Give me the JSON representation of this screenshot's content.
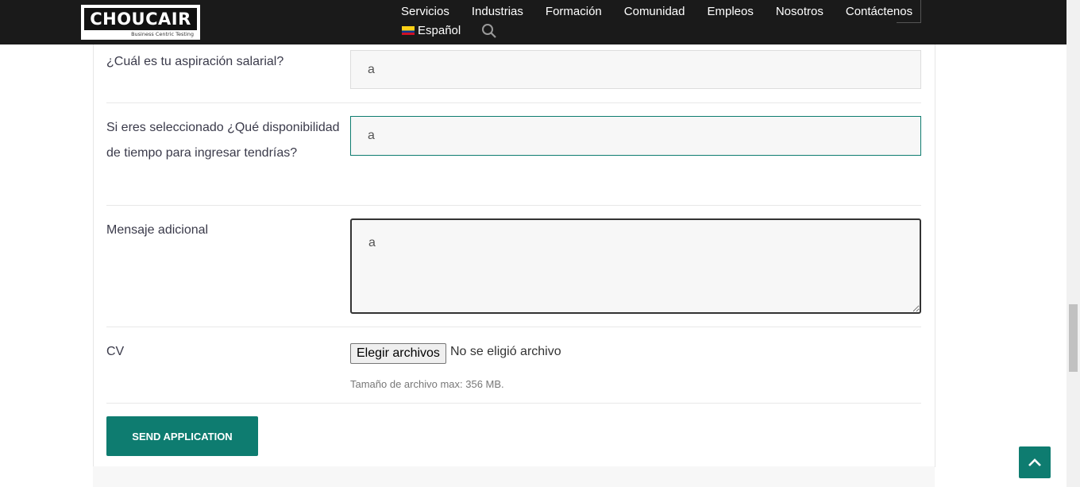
{
  "header": {
    "logo_text": "CHOUCAIR",
    "logo_sub": "Business Centric Testing",
    "nav": [
      "Servicios",
      "Industrias",
      "Formación",
      "Comunidad",
      "Empleos",
      "Nosotros",
      "Contáctenos"
    ],
    "language": "Español"
  },
  "form": {
    "salary_label": "¿Cuál es tu aspiración salarial?",
    "salary_value": "a",
    "availability_label": "Si eres seleccionado ¿Qué disponibilidad de tiempo para ingresar tendrías?",
    "availability_value": "a",
    "message_label": "Mensaje adicional",
    "message_value": "a",
    "cv_label": "CV",
    "file_button": "Elegir archivos",
    "file_status": "No se eligió archivo",
    "file_hint": "Tamaño de archivo max: 356 MB.",
    "submit_label": "SEND APPLICATION"
  },
  "colors": {
    "accent": "#0e7c70",
    "header_bg": "#1a1a1a"
  }
}
